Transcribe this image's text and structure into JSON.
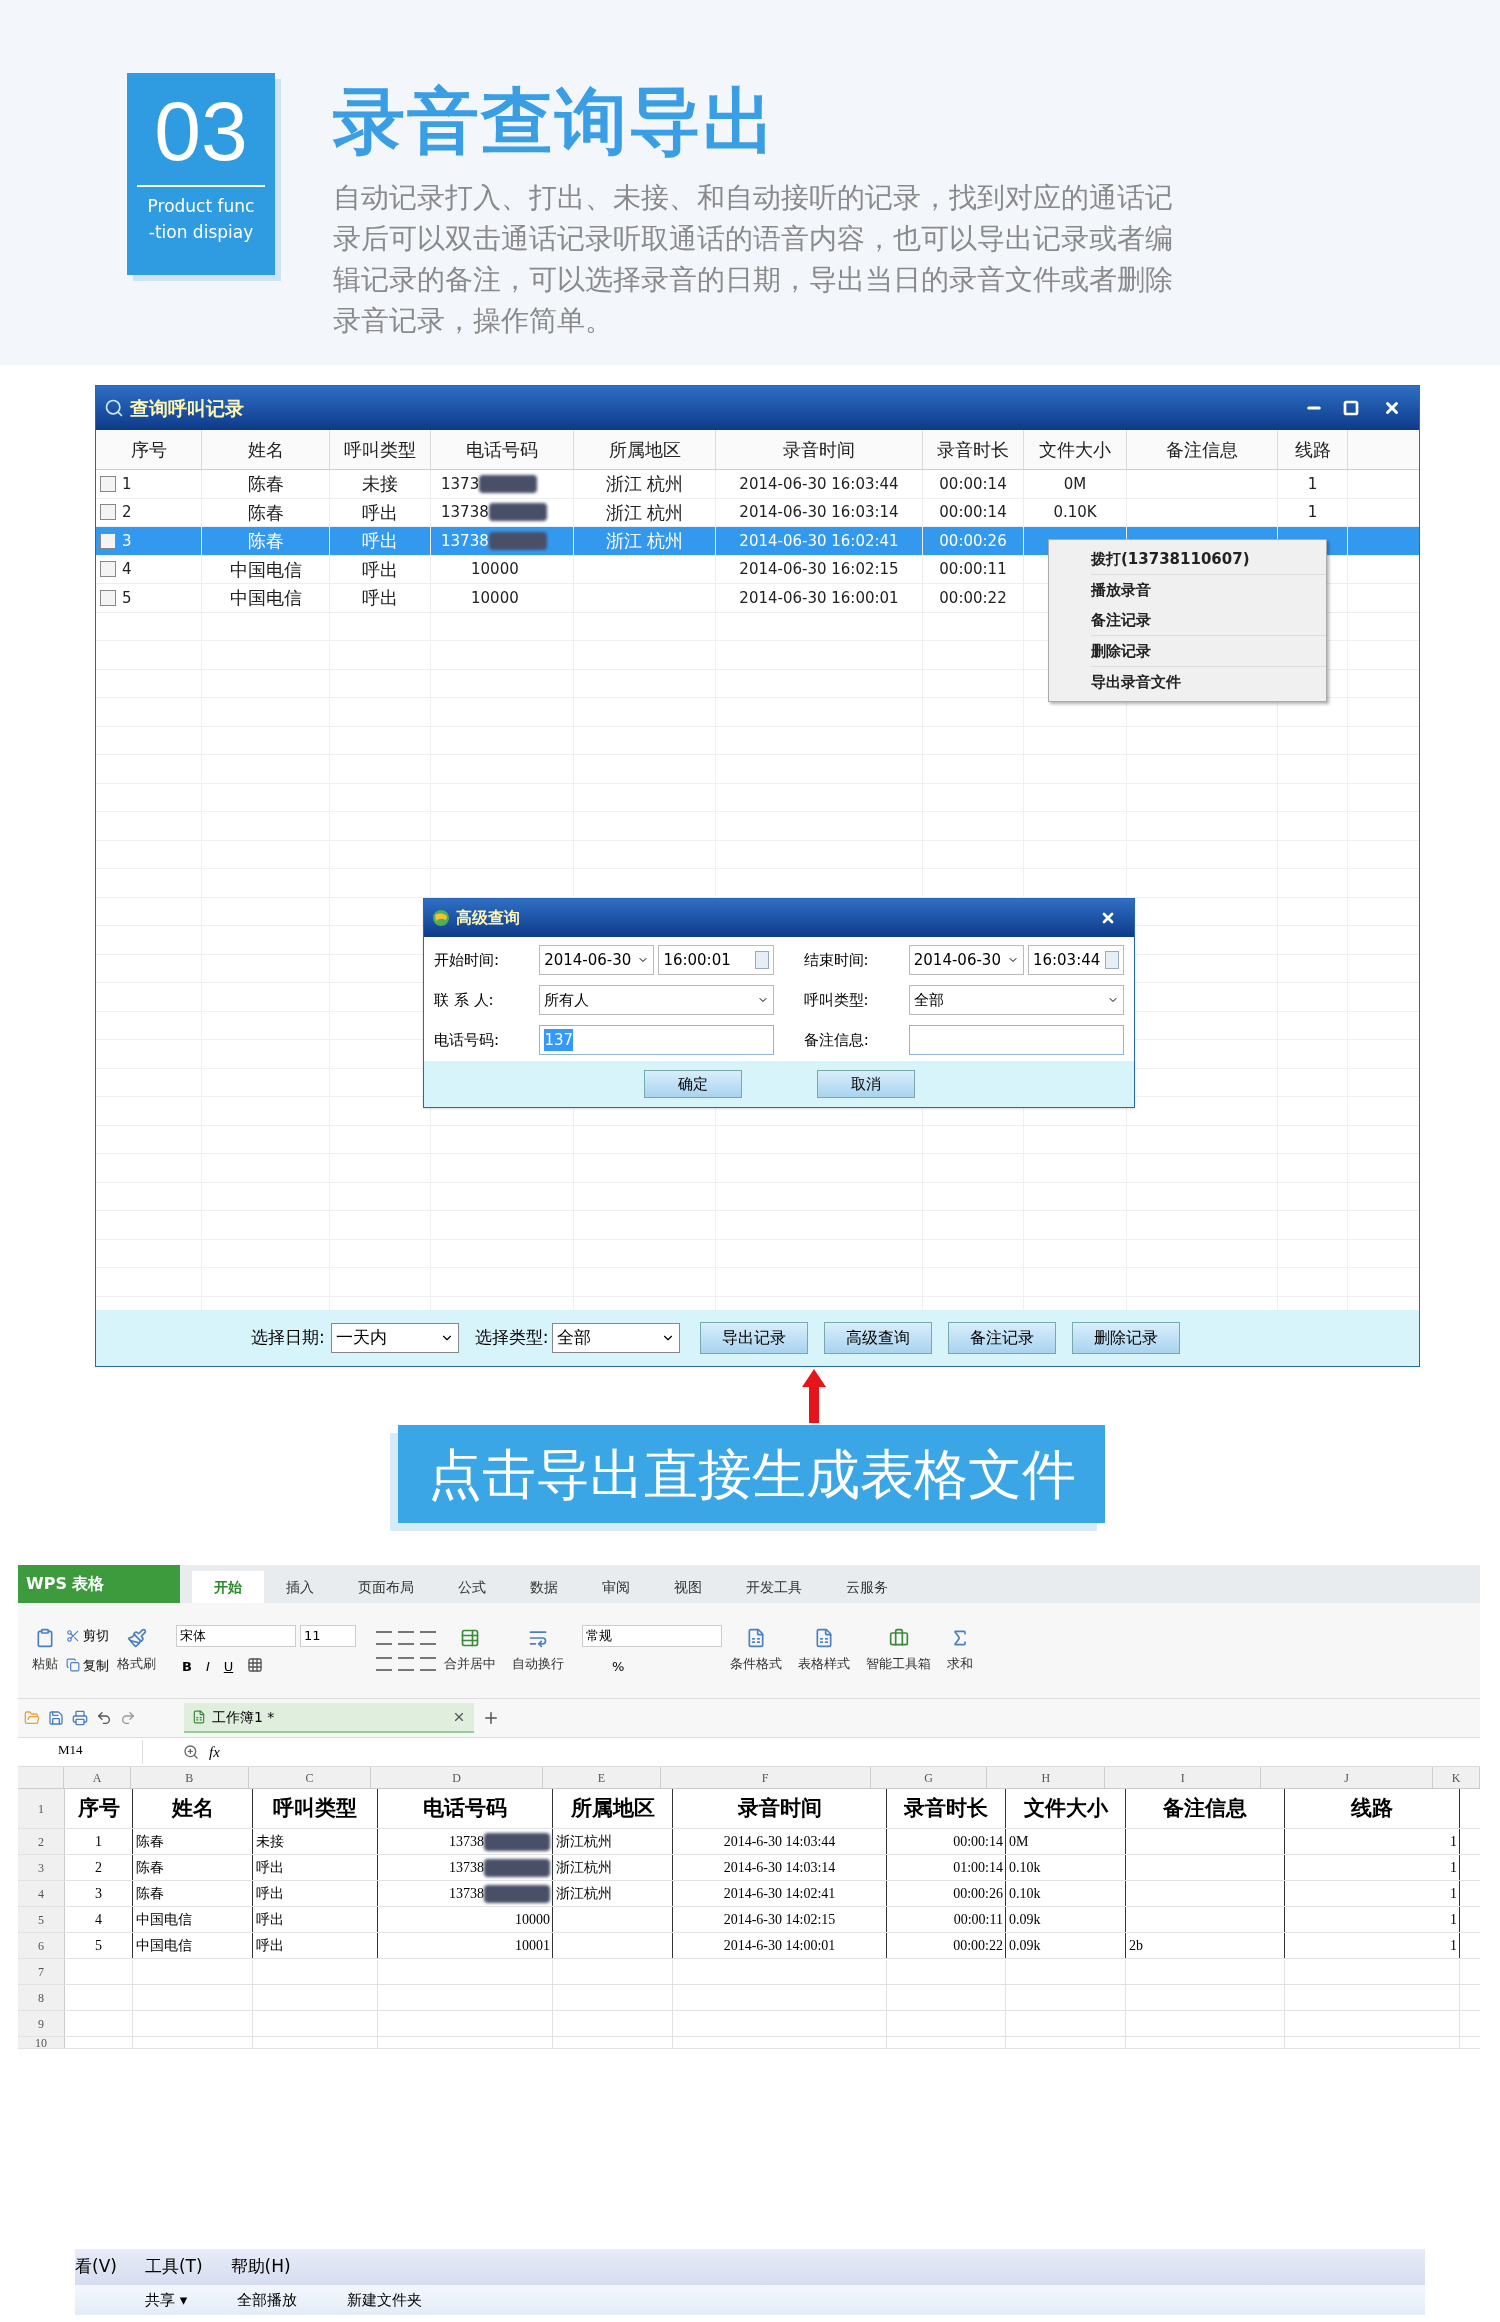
{
  "header": {
    "number": "03",
    "caption": [
      "Product func",
      "-tion dispiay"
    ],
    "title": "录音查询导出",
    "description": "自动记录打入、打出、未接、和自动接听的记录，找到对应的通话记录后可以双击通话记录听取通话的语音内容，也可以导出记录或者编辑记录的备注，可以选择录音的日期，导出当日的录音文件或者删除录音记录，操作简单。"
  },
  "call_window": {
    "title": "查询呼叫记录",
    "columns": [
      "序号",
      "姓名",
      "呼叫类型",
      "电话号码",
      "所属地区",
      "录音时间",
      "录音时长",
      "文件大小",
      "备注信息",
      "线路"
    ],
    "rows": [
      {
        "checked": false,
        "selected": false,
        "cells": [
          "1",
          "陈春",
          "未接",
          "1373",
          "浙江  杭州",
          "2014-06-30 16:03:44",
          "00:00:14",
          "0M",
          null,
          "1"
        ],
        "phone_blurred": true
      },
      {
        "checked": false,
        "selected": false,
        "cells": [
          "2",
          "陈春",
          "呼出",
          "13738",
          "浙江  杭州",
          "2014-06-30 16:03:14",
          "00:00:14",
          "0.10K",
          null,
          "1"
        ],
        "phone_blurred": true
      },
      {
        "checked": false,
        "selected": true,
        "cells": [
          "3",
          "陈春",
          "呼出",
          "13738",
          "浙江  杭州",
          "2014-06-30 16:02:41",
          "00:00:26",
          null,
          null,
          null
        ],
        "phone_blurred": true
      },
      {
        "checked": false,
        "selected": false,
        "cells": [
          "4",
          "中国电信",
          "呼出",
          "10000",
          null,
          "2014-06-30 16:02:15",
          "00:00:11",
          null,
          null,
          null
        ],
        "phone_blurred": false
      },
      {
        "checked": false,
        "selected": false,
        "cells": [
          "5",
          "中国电信",
          "呼出",
          "10000",
          null,
          "2014-06-30 16:00:01",
          "00:00:22",
          null,
          null,
          null
        ],
        "phone_blurred": false
      }
    ],
    "context_menu": [
      [
        "拨打(13738110607)"
      ],
      [
        "播放录音",
        "备注记录"
      ],
      [
        "删除记录"
      ],
      [
        "导出录音文件"
      ]
    ],
    "bottom_bar": {
      "date_label": "选择日期:",
      "date_value": "一天内",
      "type_label": "选择类型:",
      "type_value": "全部",
      "buttons": [
        "导出记录",
        "高级查询",
        "备注记录",
        "删除记录"
      ]
    },
    "dialog": {
      "title": "高级查询",
      "start_label": "开始时间:",
      "start_date": "2014-06-30",
      "start_time": "16:00:01",
      "end_label": "结束时间:",
      "end_date": "2014-06-30",
      "end_time": "16:03:44",
      "contact_label": "联 系 人:",
      "contact_value": "所有人",
      "call_type_label": "呼叫类型:",
      "call_type_value": "全部",
      "phone_label": "电话号码:",
      "phone_value": "137",
      "note_label": "备注信息:",
      "buttons": [
        "确定",
        "取消"
      ]
    }
  },
  "banner": "点击导出直接生成表格文件",
  "spreadsheet": {
    "app_button": "WPS 表格",
    "tabs": [
      {
        "label": "开始",
        "selected": true
      },
      {
        "label": "插入",
        "selected": false
      },
      {
        "label": "页面布局",
        "selected": false
      },
      {
        "label": "公式",
        "selected": false
      },
      {
        "label": "数据",
        "selected": false
      },
      {
        "label": "审阅",
        "selected": false
      },
      {
        "label": "视图",
        "selected": false
      },
      {
        "label": "开发工具",
        "selected": false
      },
      {
        "label": "云服务",
        "selected": false
      }
    ],
    "ribbon": {
      "paste": "粘贴",
      "cut": "剪切",
      "copy": "复制",
      "format_painter": "格式刷",
      "font": "宋体",
      "font_size": "11",
      "bold": "B",
      "italic": "I",
      "underline": "U",
      "merge": "合并居中",
      "wrap": "自动换行",
      "number_format": "常规",
      "percent": "%",
      "conditional": "条件格式",
      "table_style": "表格样式",
      "toolbox": "智能工具箱",
      "sum": "求和"
    },
    "doc_tab": "工作簿1 *",
    "name_box": "M14",
    "fx": "fx",
    "column_letters": [
      "A",
      "B",
      "C",
      "D",
      "E",
      "F",
      "G",
      "H",
      "I",
      "J",
      "K"
    ],
    "row_numbers": [
      "1",
      "2",
      "3",
      "4",
      "5",
      "6",
      "7",
      "8",
      "9",
      "10"
    ],
    "header": [
      "序号",
      "姓名",
      "呼叫类型",
      "电话号码",
      "所属地区",
      "录音时间",
      "录音时长",
      "文件大小",
      "备注信息",
      "线路"
    ],
    "rows": [
      {
        "cells": [
          "1",
          "陈春",
          "未接",
          "13738",
          "浙江杭州",
          "2014-6-30 14:03:44",
          "00:00:14",
          "0M",
          null,
          "1"
        ],
        "phone_blurred": true
      },
      {
        "cells": [
          "2",
          "陈春",
          "呼出",
          "13738",
          "浙江杭州",
          "2014-6-30 14:03:14",
          "01:00:14",
          "0.10k",
          null,
          "1"
        ],
        "phone_blurred": true
      },
      {
        "cells": [
          "3",
          "陈春",
          "呼出",
          "13738",
          "浙江杭州",
          "2014-6-30 14:02:41",
          "00:00:26",
          "0.10k",
          null,
          "1"
        ],
        "phone_blurred": true
      },
      {
        "cells": [
          "4",
          "中国电信",
          "呼出",
          "10000",
          null,
          "2014-6-30 14:02:15",
          "00:00:11",
          "0.09k",
          null,
          "1"
        ],
        "phone_blurred": false
      },
      {
        "cells": [
          "5",
          "中国电信",
          "呼出",
          "10001",
          null,
          "2014-6-30 14:00:01",
          "00:00:22",
          "0.09k",
          "2b",
          "1"
        ],
        "phone_blurred": false
      }
    ]
  },
  "explorer": {
    "menu": [
      "看(V)",
      "工具(T)",
      "帮助(H)"
    ],
    "toolbar": [
      "共享 ▾",
      "全部播放",
      "新建文件夹"
    ]
  }
}
